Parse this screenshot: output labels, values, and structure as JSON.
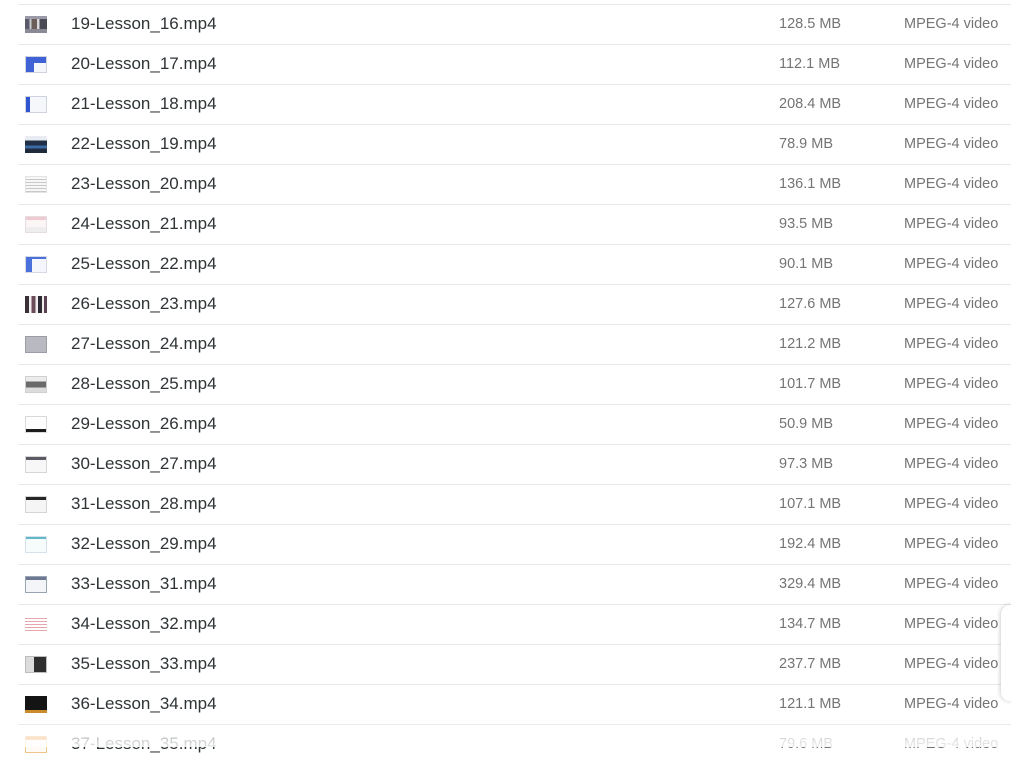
{
  "files": [
    {
      "name": "19-Lesson_16.mp4",
      "size": "128.5 MB",
      "type": "MPEG-4 video",
      "thumb": "t-collage"
    },
    {
      "name": "20-Lesson_17.mp4",
      "size": "112.1 MB",
      "type": "MPEG-4 video",
      "thumb": "t-blue-doc"
    },
    {
      "name": "21-Lesson_18.mp4",
      "size": "208.4 MB",
      "type": "MPEG-4 video",
      "thumb": "t-blue-doc2"
    },
    {
      "name": "22-Lesson_19.mp4",
      "size": "78.9 MB",
      "type": "MPEG-4 video",
      "thumb": "t-landscape"
    },
    {
      "name": "23-Lesson_20.mp4",
      "size": "136.1 MB",
      "type": "MPEG-4 video",
      "thumb": "t-text"
    },
    {
      "name": "24-Lesson_21.mp4",
      "size": "93.5 MB",
      "type": "MPEG-4 video",
      "thumb": "t-pink"
    },
    {
      "name": "25-Lesson_22.mp4",
      "size": "90.1 MB",
      "type": "MPEG-4 video",
      "thumb": "t-blue-bar"
    },
    {
      "name": "26-Lesson_23.mp4",
      "size": "127.6 MB",
      "type": "MPEG-4 video",
      "thumb": "t-people"
    },
    {
      "name": "27-Lesson_24.mp4",
      "size": "121.2 MB",
      "type": "MPEG-4 video",
      "thumb": "t-gray"
    },
    {
      "name": "28-Lesson_25.mp4",
      "size": "101.7 MB",
      "type": "MPEG-4 video",
      "thumb": "t-photo"
    },
    {
      "name": "29-Lesson_26.mp4",
      "size": "50.9 MB",
      "type": "MPEG-4 video",
      "thumb": "t-white"
    },
    {
      "name": "30-Lesson_27.mp4",
      "size": "97.3 MB",
      "type": "MPEG-4 video",
      "thumb": "t-web"
    },
    {
      "name": "31-Lesson_28.mp4",
      "size": "107.1 MB",
      "type": "MPEG-4 video",
      "thumb": "t-dark-top"
    },
    {
      "name": "32-Lesson_29.mp4",
      "size": "192.4 MB",
      "type": "MPEG-4 video",
      "thumb": "t-teal"
    },
    {
      "name": "33-Lesson_31.mp4",
      "size": "329.4 MB",
      "type": "MPEG-4 video",
      "thumb": "t-frame"
    },
    {
      "name": "34-Lesson_32.mp4",
      "size": "134.7 MB",
      "type": "MPEG-4 video",
      "thumb": "t-lines-red"
    },
    {
      "name": "35-Lesson_33.mp4",
      "size": "237.7 MB",
      "type": "MPEG-4 video",
      "thumb": "t-poster"
    },
    {
      "name": "36-Lesson_34.mp4",
      "size": "121.1 MB",
      "type": "MPEG-4 video",
      "thumb": "t-dark"
    },
    {
      "name": "37-Lesson_35.mp4",
      "size": "79.6 MB",
      "type": "MPEG-4 video",
      "thumb": "t-orange"
    }
  ],
  "colors": {
    "background": "#ffffff",
    "name_text": "#2e3436",
    "meta_text": "#747474",
    "row_divider": "#e8e8e8"
  }
}
